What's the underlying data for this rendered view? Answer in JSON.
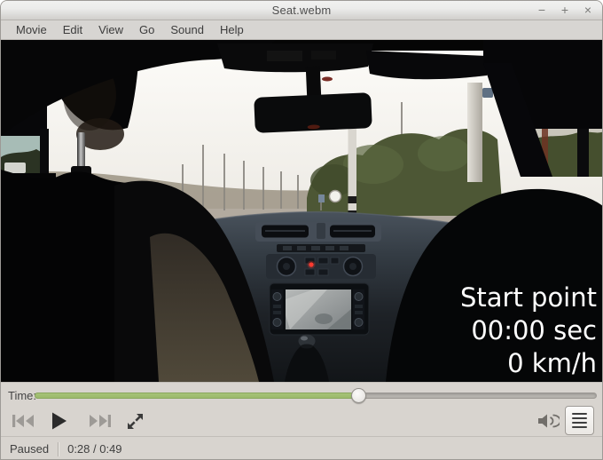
{
  "window": {
    "title": "Seat.webm",
    "minimize": "−",
    "maximize": "+",
    "close": "×"
  },
  "menubar": {
    "items": [
      "Movie",
      "Edit",
      "View",
      "Go",
      "Sound",
      "Help"
    ]
  },
  "video": {
    "overlay": {
      "line1": "Start point",
      "line2": "00:00 sec",
      "line3": "0 km/h"
    }
  },
  "transport": {
    "time_label": "Time:",
    "progress_percent": 57.6,
    "icons": {
      "previous": "skip-backward",
      "play": "play-triangle",
      "next": "skip-forward",
      "fullscreen": "expand-arrows",
      "volume": "speaker-high",
      "playlist": "hamburger-lines"
    }
  },
  "statusbar": {
    "state": "Paused",
    "position": "0:28 / 0:49"
  },
  "colors": {
    "accent_green": "#a6c377",
    "accent_green_dark": "#8aa75e",
    "panel_bg": "#d8d4cf",
    "titlebar_top": "#ececeb",
    "titlebar_bottom": "#d0cecb",
    "menubar_bg": "#d7d5d2",
    "overlay_text": "#ffffff",
    "status_text": "#3f3f3f"
  }
}
